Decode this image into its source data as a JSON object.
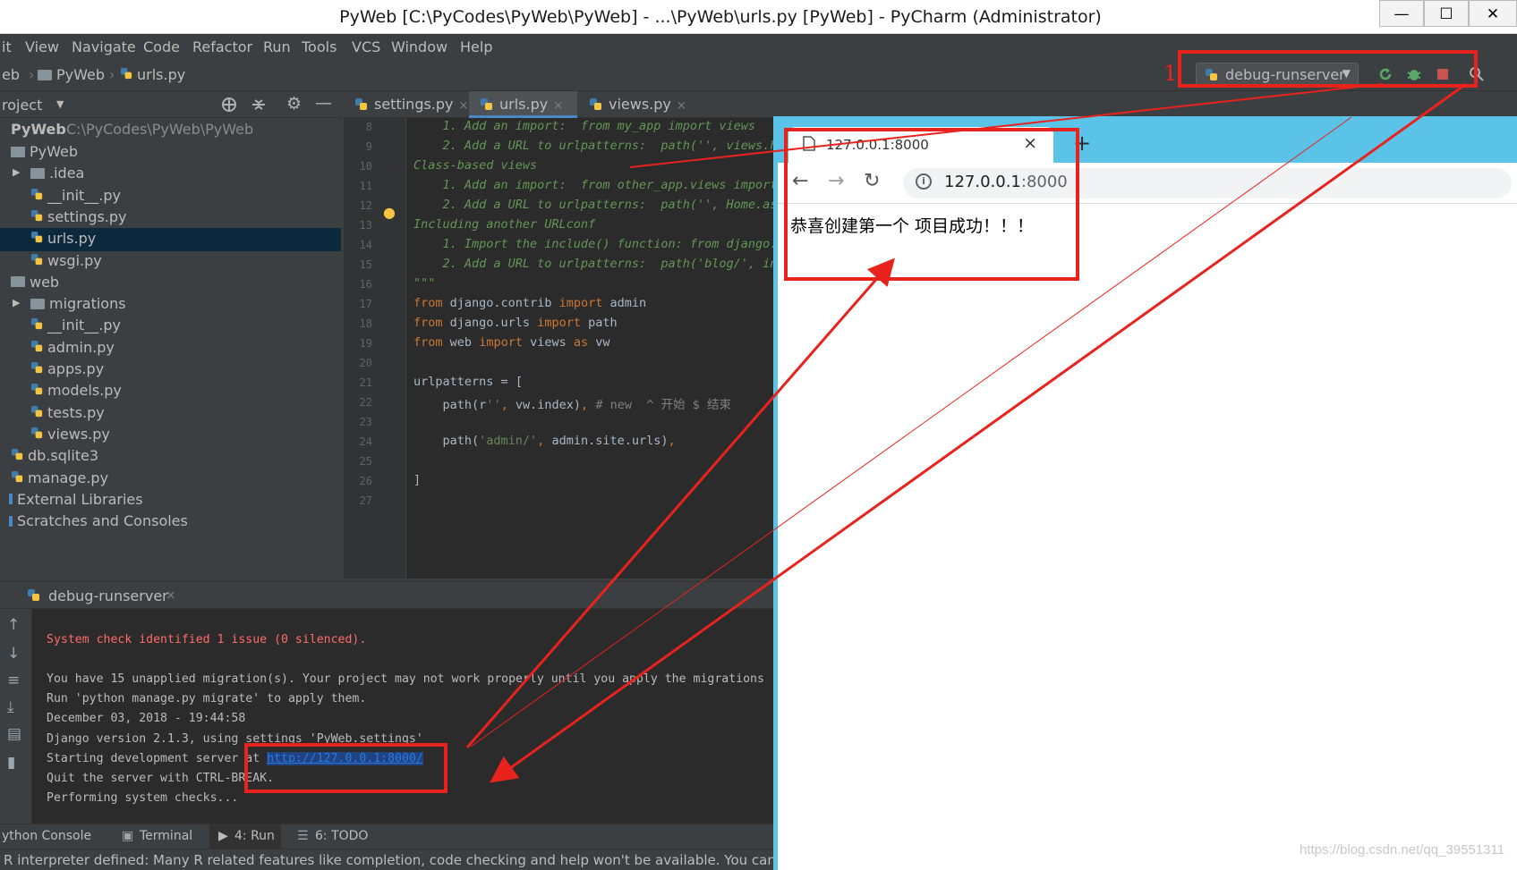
{
  "window": {
    "title": "PyWeb [C:\\PyCodes\\PyWeb\\PyWeb] - ...\\PyWeb\\urls.py [PyWeb] - PyCharm (Administrator)",
    "minimize": "—",
    "maximize": "☐",
    "close": "✕"
  },
  "menu": [
    "it",
    "View",
    "Navigate",
    "Code",
    "Refactor",
    "Run",
    "Tools",
    "VCS",
    "Window",
    "Help"
  ],
  "breadcrumbs": [
    "eb",
    "PyWeb",
    "urls.py"
  ],
  "run_config": {
    "label": "debug-runserver"
  },
  "annotation_number": "1",
  "project_panel": {
    "title": "roject",
    "root_name": "PyWeb",
    "root_path": "C:\\PyCodes\\PyWeb\\PyWeb",
    "items": [
      {
        "label": "PyWeb",
        "type": "folder",
        "depth": 0
      },
      {
        "label": ".idea",
        "type": "folder",
        "depth": 1,
        "arrow": "▶"
      },
      {
        "label": "__init__.py",
        "type": "py",
        "depth": 1
      },
      {
        "label": "settings.py",
        "type": "py",
        "depth": 1
      },
      {
        "label": "urls.py",
        "type": "py",
        "depth": 1,
        "selected": true
      },
      {
        "label": "wsgi.py",
        "type": "py",
        "depth": 1
      },
      {
        "label": "web",
        "type": "folder",
        "depth": 0
      },
      {
        "label": "migrations",
        "type": "folder",
        "depth": 1,
        "arrow": "▶"
      },
      {
        "label": "__init__.py",
        "type": "py",
        "depth": 1
      },
      {
        "label": "admin.py",
        "type": "py",
        "depth": 1
      },
      {
        "label": "apps.py",
        "type": "py",
        "depth": 1
      },
      {
        "label": "models.py",
        "type": "py",
        "depth": 1
      },
      {
        "label": "tests.py",
        "type": "py",
        "depth": 1
      },
      {
        "label": "views.py",
        "type": "py",
        "depth": 1
      },
      {
        "label": "db.sqlite3",
        "type": "db",
        "depth": 0
      },
      {
        "label": "manage.py",
        "type": "py",
        "depth": 0
      },
      {
        "label": "External Libraries",
        "type": "lib",
        "depth": -1
      },
      {
        "label": "Scratches and Consoles",
        "type": "lib",
        "depth": -1
      }
    ]
  },
  "editor_tabs": [
    {
      "label": "settings.py",
      "close": "×"
    },
    {
      "label": "urls.py",
      "close": "×",
      "active": true
    },
    {
      "label": "views.py",
      "close": "×"
    }
  ],
  "editor": {
    "line_numbers": [
      "8",
      "9",
      "10",
      "11",
      "12",
      "13",
      "14",
      "15",
      "16",
      "17",
      "18",
      "19",
      "20",
      "21",
      "22",
      "23",
      "24",
      "25",
      "26",
      "27"
    ],
    "lines": [
      {
        "t": "    1. Add an import:  from my_app import views",
        "c": "cm"
      },
      {
        "t": "    2. Add a URL to urlpatterns:  path('', views.h",
        "c": "cm"
      },
      {
        "t": "Class-based views",
        "c": "cm"
      },
      {
        "t": "    1. Add an import:  from other_app.views import",
        "c": "cm"
      },
      {
        "t": "    2. Add a URL to urlpatterns:  path('', Home.as",
        "c": "cm"
      },
      {
        "t": "Including another URLconf",
        "c": "cm"
      },
      {
        "t": "    1. Import the include() function: from django.",
        "c": "cm"
      },
      {
        "t": "    2. Add a URL to urlpatterns:  path('blog/', in",
        "c": "cm"
      },
      {
        "t": "\"\"\"",
        "c": "cm"
      },
      {
        "t": "from django.contrib import admin",
        "c": "code"
      },
      {
        "t": "from django.urls import path",
        "c": "code"
      },
      {
        "t": "from web import views as vw",
        "c": "code"
      },
      {
        "t": "",
        "c": "code"
      },
      {
        "t": "urlpatterns = [",
        "c": "code"
      },
      {
        "t": "    path(r'', vw.index), # new  ^ 开始 $ 结束",
        "c": "code"
      },
      {
        "t": "",
        "c": "code"
      },
      {
        "t": "    path('admin/', admin.site.urls),",
        "c": "code"
      },
      {
        "t": "",
        "c": "code"
      },
      {
        "t": "]",
        "c": "code"
      },
      {
        "t": "",
        "c": "code"
      }
    ]
  },
  "run_panel": {
    "tab_label": "debug-runserver",
    "tab_close": "×",
    "console": [
      {
        "t": "System check identified 1 issue (0 silenced).",
        "c": "err"
      },
      {
        "t": "",
        "c": ""
      },
      {
        "t": "You have 15 unapplied migration(s). Your project may not work properly until you apply the migrations",
        "c": ""
      },
      {
        "t": "Run 'python manage.py migrate' to apply them.",
        "c": ""
      },
      {
        "t": "December 03, 2018 - 19:44:58",
        "c": ""
      },
      {
        "t": "Django version 2.1.3, using settings 'PyWeb.settings'",
        "c": ""
      },
      {
        "t": "Starting development server at ",
        "c": "",
        "link": "http://127.0.0.1:8000/"
      },
      {
        "t": "Quit the server with CTRL-BREAK.",
        "c": ""
      },
      {
        "t": "Performing system checks...",
        "c": ""
      }
    ]
  },
  "tool_tabs": [
    {
      "label": "ython Console"
    },
    {
      "label": "Terminal"
    },
    {
      "label": "4: Run"
    },
    {
      "label": "6: TODO"
    }
  ],
  "status_text": "R interpreter defined: Many R related features like completion, code checking and help won't be available. You can set",
  "browser": {
    "tab_title": "127.0.0.1:8000",
    "tab_close": "×",
    "new_tab": "+",
    "back": "←",
    "forward": "→",
    "reload": "↻",
    "info": "i",
    "url_host": "127.0.0.1",
    "url_port": ":8000",
    "page_text": "恭喜创建第一个 项目成功！！！"
  },
  "watermark": "https://blog.csdn.net/qq_39551311"
}
